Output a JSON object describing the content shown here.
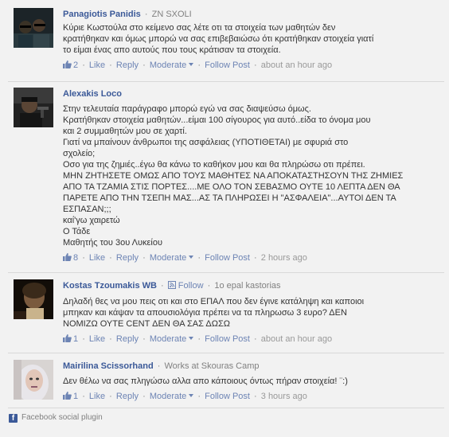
{
  "comments": [
    {
      "name": "Panagiotis Panidis",
      "meta": "ZN SXOLI",
      "lines": [
        "Κύριε Κωστούλα στο κείμενο σας λέτε οτι τα στοιχεία των μαθητών δεν",
        "κρατήθηκαν και όμως μπορώ να σας επιβεβαιώσω ότι κρατήθηκαν στοιχεία γιατί",
        "το είμαι ένας απο αυτούς που τους κράτισαν τα στοιχεία."
      ],
      "likes": "2",
      "like_label": "Like",
      "reply_label": "Reply",
      "moderate_label": "Moderate",
      "follow_label": "Follow Post",
      "time": "about an hour ago"
    },
    {
      "name": "Alexakis Loco",
      "meta": "",
      "lines": [
        "Στην τελευταία παράγραφο μπορώ εγώ να σας διαψεύσω όμως.",
        "Κρατήθηκαν στοιχεία μαθητών...είμαι 100 σίγουρος για αυτό..είδα το όνομα μου",
        "και 2 συμμαθητών μου σε χαρτί.",
        "Γιατί να μπαίνουν άνθρωποι της ασφάλειας (ΥΠΟΤΙΘΕΤΑΙ) με σφυριά στο",
        "σχολείο;",
        "Οσο για της ζημιές..έγω θα κάνω το καθήκον μου και θα πληρώσω οτι πρέπει.",
        "ΜΗΝ ΖΗΤΗΣΕΤΕ ΟΜΩΣ ΑΠΟ ΤΟΥΣ ΜΑΘΗΤΕΣ ΝΑ ΑΠΟΚΑΤΑΣΤΗΣΟΥΝ ΤΗΣ ΖΗΜΙΕΣ",
        "ΑΠΟ ΤΑ ΤΖΑΜΙΑ ΣΤΙΣ ΠΟΡΤΕΣ....ΜΕ ΟΛΟ ΤΟΝ ΣΕΒΑΣΜΟ ΟΥΤΕ 10 ΛΕΠΤΑ ΔΕΝ ΘΑ",
        "ΠΑΡΕΤΕ ΑΠΟ ΤΗΝ ΤΣΕΠΗ ΜΑΣ...ΑΣ ΤΑ ΠΛΗΡΩΣΕΙ Η \"ΑΣΦΑΛΕΙΑ\"...ΑΥΤΟΙ ΔΕΝ ΤΑ",
        "ΕΣΠΑΣΑΝ;;;",
        "καί'γω χαιρετώ",
        "Ο Τάδε",
        "Μαθητής του 3ου Λυκείου"
      ],
      "likes": "8",
      "like_label": "Like",
      "reply_label": "Reply",
      "moderate_label": "Moderate",
      "follow_label": "Follow Post",
      "time": "2 hours ago"
    },
    {
      "name": "Kostas Tzoumakis WB",
      "meta": "1o epal kastorias",
      "follow_user_label": "Follow",
      "lines": [
        "Δηλαδή θες να μου πεις οτι και στο ΕΠΑΛ που δεν έγινε κατάληψη και καποιοι",
        "μπηκαν και κάψαν τα απουσιολόγια πρέπει να τα πληρωσω 3 ευρο? ΔΕΝ",
        "ΝΟΜΙΖΩ ΟΥΤΕ CENT ΔΕΝ ΘΑ ΣΑΣ ΔΩΣΩ"
      ],
      "likes": "1",
      "like_label": "Like",
      "reply_label": "Reply",
      "moderate_label": "Moderate",
      "follow_label": "Follow Post",
      "time": "about an hour ago"
    },
    {
      "name": "Mairilina Scissorhand",
      "meta": "Works at Skouras Camp",
      "lines": [
        "Δεν θέλω να σας πληγώσω αλλα απο κάποιους όντως πήραν στοιχεία! ¨:)"
      ],
      "likes": "1",
      "like_label": "Like",
      "reply_label": "Reply",
      "moderate_label": "Moderate",
      "follow_label": "Follow Post",
      "time": "3 hours ago"
    }
  ],
  "footer": {
    "label": "Facebook social plugin"
  },
  "colors": {
    "link": "#3b5998",
    "action": "#6d84b4",
    "muted": "#808080"
  }
}
